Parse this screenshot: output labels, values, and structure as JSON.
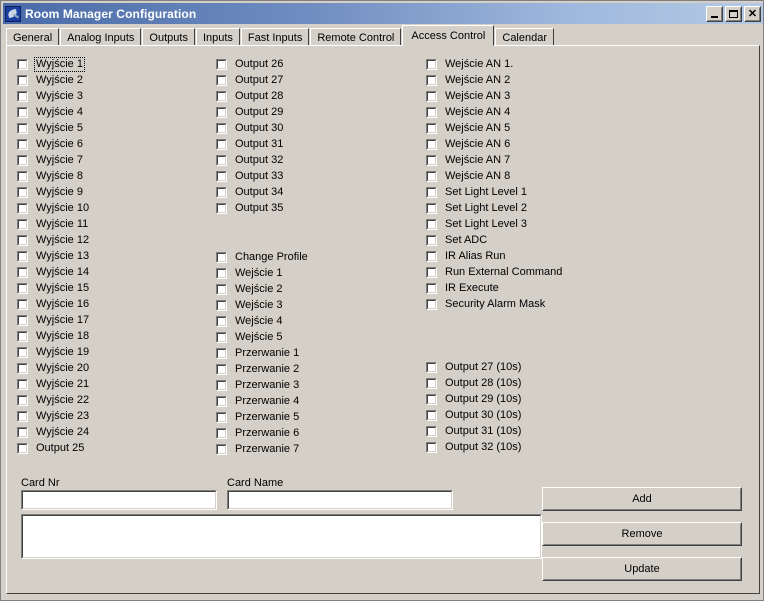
{
  "window": {
    "title": "Room Manager Configuration",
    "icon": "satellite-dish-icon",
    "buttons": {
      "minimize": "_",
      "maximize": "□",
      "close": "✕"
    }
  },
  "tabs": [
    {
      "label": "General",
      "active": false
    },
    {
      "label": "Analog Inputs",
      "active": false
    },
    {
      "label": "Outputs",
      "active": false
    },
    {
      "label": "Inputs",
      "active": false
    },
    {
      "label": "Fast Inputs",
      "active": false
    },
    {
      "label": "Remote Control",
      "active": false
    },
    {
      "label": "Access Control",
      "active": true
    },
    {
      "label": "Calendar",
      "active": false
    }
  ],
  "access_control": {
    "column1": [
      {
        "label": "Wyjście 1",
        "checked": false,
        "focused": true
      },
      {
        "label": "Wyjście 2",
        "checked": false
      },
      {
        "label": "Wyjście 3",
        "checked": false
      },
      {
        "label": "Wyjście 4",
        "checked": false
      },
      {
        "label": "Wyjście 5",
        "checked": false
      },
      {
        "label": "Wyjście 6",
        "checked": false
      },
      {
        "label": "Wyjście 7",
        "checked": false
      },
      {
        "label": "Wyjście 8",
        "checked": false
      },
      {
        "label": "Wyjście 9",
        "checked": false
      },
      {
        "label": "Wyjście 10",
        "checked": false
      },
      {
        "label": "Wyjście 11",
        "checked": false
      },
      {
        "label": "Wyjście 12",
        "checked": false
      },
      {
        "label": "Wyjście 13",
        "checked": false
      },
      {
        "label": "Wyjście 14",
        "checked": false
      },
      {
        "label": "Wyjście 15",
        "checked": false
      },
      {
        "label": "Wyjście 16",
        "checked": false
      },
      {
        "label": "Wyjście 17",
        "checked": false
      },
      {
        "label": "Wyjście 18",
        "checked": false
      },
      {
        "label": "Wyjście 19",
        "checked": false
      },
      {
        "label": "Wyjście 20",
        "checked": false
      },
      {
        "label": "Wyjście 21",
        "checked": false
      },
      {
        "label": "Wyjście 22",
        "checked": false
      },
      {
        "label": "Wyjście 23",
        "checked": false
      },
      {
        "label": "Wyjście 24",
        "checked": false
      },
      {
        "label": "Output 25",
        "checked": false
      }
    ],
    "column2_group1": [
      {
        "label": "Output 26",
        "checked": false
      },
      {
        "label": "Output 27",
        "checked": false
      },
      {
        "label": "Output 28",
        "checked": false
      },
      {
        "label": "Output 29",
        "checked": false
      },
      {
        "label": "Output 30",
        "checked": false
      },
      {
        "label": "Output 31",
        "checked": false
      },
      {
        "label": "Output 32",
        "checked": false
      },
      {
        "label": "Output 33",
        "checked": false
      },
      {
        "label": "Output 34",
        "checked": false
      },
      {
        "label": "Output 35",
        "checked": false
      }
    ],
    "column2_group2": [
      {
        "label": "Change Profile",
        "checked": false
      },
      {
        "label": "Wejście 1",
        "checked": false
      },
      {
        "label": "Wejście 2",
        "checked": false
      },
      {
        "label": "Wejście 3",
        "checked": false
      },
      {
        "label": "Wejście 4",
        "checked": false
      },
      {
        "label": "Wejście 5",
        "checked": false
      },
      {
        "label": "Przerwanie 1",
        "checked": false
      },
      {
        "label": "Przerwanie 2",
        "checked": false
      },
      {
        "label": "Przerwanie 3",
        "checked": false
      },
      {
        "label": "Przerwanie 4",
        "checked": false
      },
      {
        "label": "Przerwanie 5",
        "checked": false
      },
      {
        "label": "Przerwanie 6",
        "checked": false
      },
      {
        "label": "Przerwanie 7",
        "checked": false
      }
    ],
    "column3_group1": [
      {
        "label": "Wejście AN 1.",
        "checked": false
      },
      {
        "label": "Wejście AN 2",
        "checked": false
      },
      {
        "label": "Wejście AN 3",
        "checked": false
      },
      {
        "label": "Wejście AN 4",
        "checked": false
      },
      {
        "label": "Wejście AN 5",
        "checked": false
      },
      {
        "label": "Wejście AN 6",
        "checked": false
      },
      {
        "label": "Wejście AN 7",
        "checked": false
      },
      {
        "label": "Wejście AN 8",
        "checked": false
      },
      {
        "label": "Set Light Level 1",
        "checked": false
      },
      {
        "label": "Set Light Level 2",
        "checked": false
      },
      {
        "label": "Set Light Level 3",
        "checked": false
      },
      {
        "label": "Set ADC",
        "checked": false
      },
      {
        "label": "IR Alias Run",
        "checked": false
      },
      {
        "label": "Run External Command",
        "checked": false
      },
      {
        "label": "IR Execute",
        "checked": false
      },
      {
        "label": "Security Alarm Mask",
        "checked": false
      }
    ],
    "column3_group2": [
      {
        "label": "Output 27 (10s)",
        "checked": false
      },
      {
        "label": "Output 28 (10s)",
        "checked": false
      },
      {
        "label": "Output 29 (10s)",
        "checked": false
      },
      {
        "label": "Output 30 (10s)",
        "checked": false
      },
      {
        "label": "Output 31 (10s)",
        "checked": false
      },
      {
        "label": "Output 32 (10s)",
        "checked": false
      }
    ],
    "card_nr": {
      "label": "Card Nr",
      "value": "",
      "placeholder": ""
    },
    "card_name": {
      "label": "Card Name",
      "value": "",
      "placeholder": ""
    },
    "card_list": {
      "value": "",
      "placeholder": ""
    },
    "actions": {
      "add": "Add",
      "remove": "Remove",
      "update": "Update"
    }
  }
}
